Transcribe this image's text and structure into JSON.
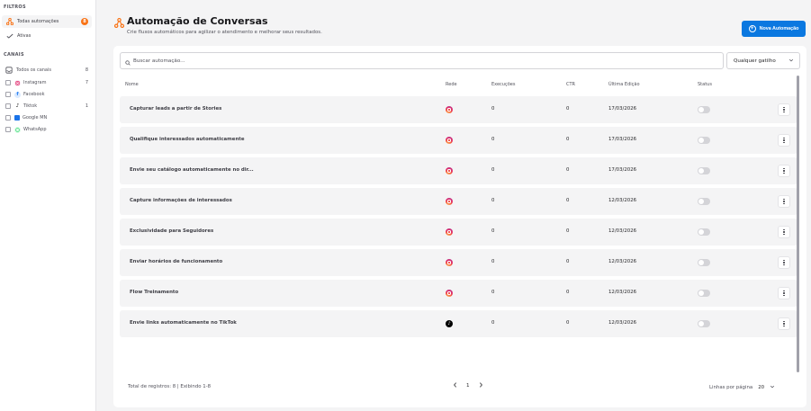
{
  "sidebar": {
    "filters_title": "FILTROS",
    "filters": [
      {
        "label": "Todas automações",
        "badge": "8",
        "icon": "automation-icon"
      },
      {
        "label": "Ativas",
        "icon": "check-icon"
      }
    ],
    "channels_title": "CANAIS",
    "channels": [
      {
        "label": "Todos os canais",
        "count": "8"
      },
      {
        "label": "Instagram",
        "count": "7",
        "icon": "instagram-icon"
      },
      {
        "label": "Facebook",
        "count": "",
        "icon": "facebook-icon"
      },
      {
        "label": "Tiktok",
        "count": "1",
        "icon": "tiktok-icon"
      },
      {
        "label": "Google MN",
        "count": "",
        "icon": "google-mn-icon"
      },
      {
        "label": "WhatsApp",
        "count": "",
        "icon": "whatsapp-icon"
      }
    ]
  },
  "header": {
    "title": "Automação de Conversas",
    "subtitle": "Crie fluxos automáticos para agilizar o atendimento e melhorar seus resultados.",
    "new_button": "Nova Automação"
  },
  "toolbar": {
    "search_placeholder": "Buscar automação...",
    "trigger_select": "Qualquer gatilho"
  },
  "table": {
    "headers": {
      "name": "Nome",
      "network": "Rede",
      "executions": "Execuções",
      "ctr": "CTR",
      "last_edit": "Última Edição",
      "status": "Status"
    },
    "rows": [
      {
        "name": "Capturar leads a partir de Stories",
        "network": "instagram",
        "executions": "0",
        "ctr": "0",
        "last_edit": "17/03/2026"
      },
      {
        "name": "Qualifique interessados automaticamente",
        "network": "instagram",
        "executions": "0",
        "ctr": "0",
        "last_edit": "17/03/2026"
      },
      {
        "name": "Envie seu catálogo automaticamente no dir...",
        "network": "instagram",
        "executions": "0",
        "ctr": "0",
        "last_edit": "17/03/2026"
      },
      {
        "name": "Capture informações de interessados",
        "network": "instagram",
        "executions": "0",
        "ctr": "0",
        "last_edit": "12/03/2026"
      },
      {
        "name": "Exclusividade para Seguidores",
        "network": "instagram",
        "executions": "0",
        "ctr": "0",
        "last_edit": "12/03/2026"
      },
      {
        "name": "Enviar horários de funcionamento",
        "network": "instagram",
        "executions": "0",
        "ctr": "0",
        "last_edit": "12/03/2026"
      },
      {
        "name": "Flow Treinamento",
        "network": "instagram",
        "executions": "0",
        "ctr": "0",
        "last_edit": "12/03/2026"
      },
      {
        "name": "Envie links automaticamente no TikTok",
        "network": "tiktok",
        "executions": "0",
        "ctr": "0",
        "last_edit": "12/03/2026"
      }
    ]
  },
  "footer": {
    "total": "Total de registros: 8 | Exibindo 1-8",
    "page": "1",
    "rows_per_page_label": "Linhas por página",
    "rows_per_page_value": "20"
  },
  "colors": {
    "accent": "#0b78e0",
    "brand_orange": "#f97316"
  }
}
